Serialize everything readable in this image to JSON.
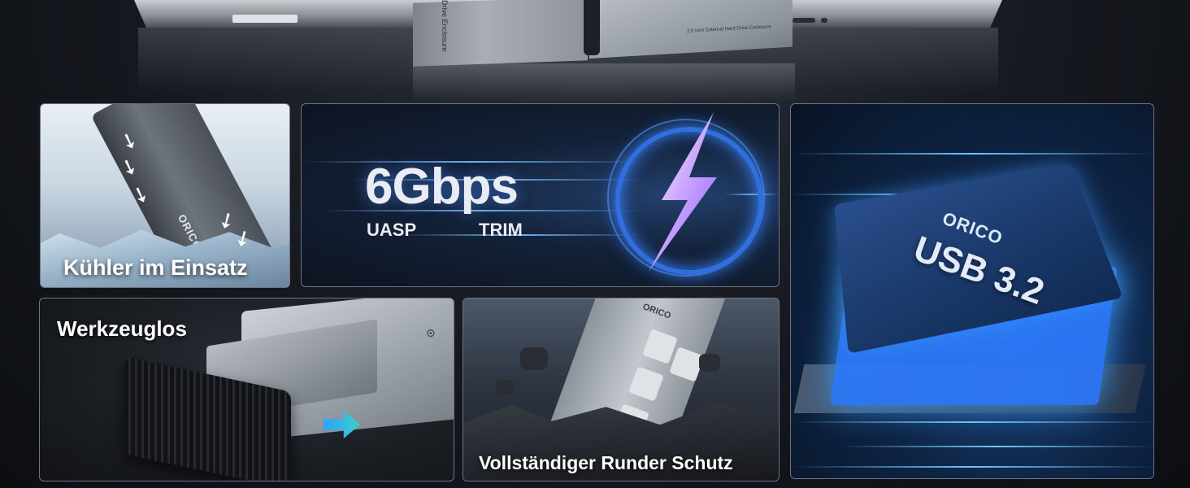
{
  "hero": {
    "drive_side_text": "Drive Enclosure",
    "drive_top_text": "2.5 Inch External Hard Drive Enclosure"
  },
  "cards": {
    "cooling": {
      "caption": "Kühler im Einsatz",
      "logo": "ORICO"
    },
    "speed": {
      "title": "6Gbps",
      "features": [
        "UASP",
        "TRIM"
      ]
    },
    "chip": {
      "brand": "ORICO",
      "label": "USB 3.2"
    },
    "toolless": {
      "caption": "Werkzeuglos"
    },
    "protection": {
      "caption": "Vollständiger Runder Schutz",
      "brand": "ORICO"
    }
  },
  "colors": {
    "accent_blue": "#2f6fe0",
    "text_white": "#ffffff",
    "bolt_purple": "#b57bff"
  },
  "icons": [
    "lightning-bolt-icon",
    "arrow-right-icon",
    "airflow-arrow-icon"
  ]
}
